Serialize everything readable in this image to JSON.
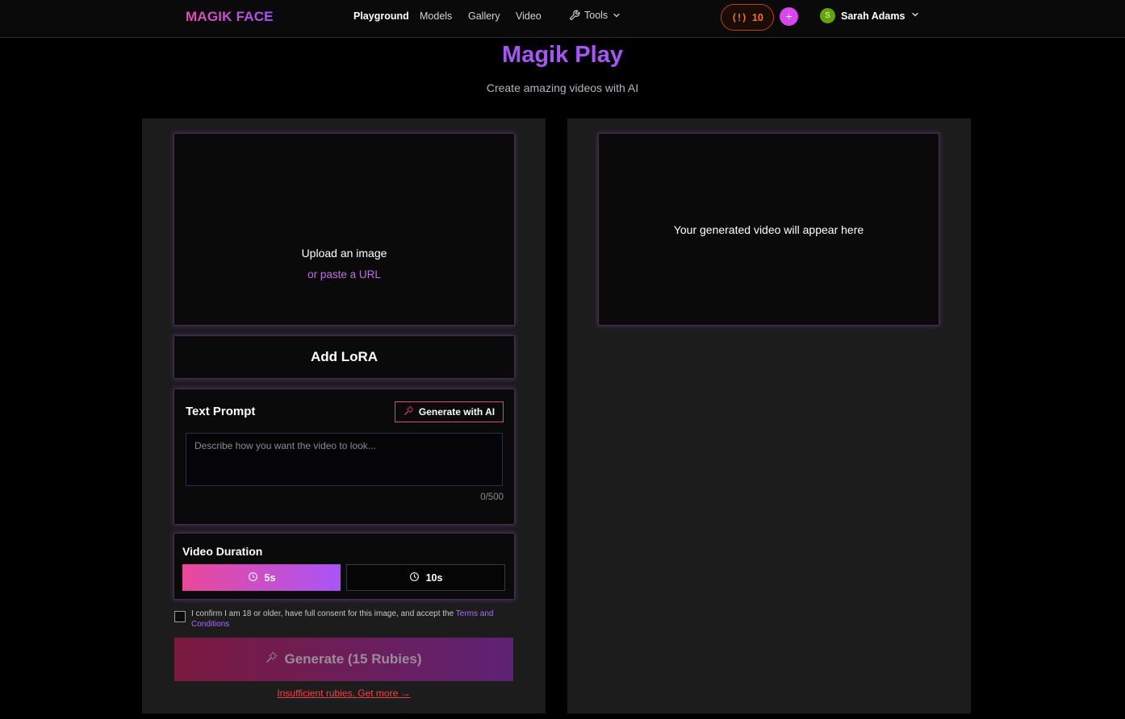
{
  "nav": {
    "logo": "MAGIK FACE",
    "links": [
      {
        "label": "Playground",
        "active": true
      },
      {
        "label": "Models",
        "active": false
      },
      {
        "label": "Gallery",
        "active": false
      },
      {
        "label": "Video",
        "active": false
      }
    ],
    "tools_label": "Tools",
    "ruby_icon": "(!)",
    "ruby_count": "10",
    "plus_label": "+",
    "user": {
      "initial": "S",
      "name": "Sarah Adams"
    }
  },
  "hero": {
    "title": "Magik Play",
    "subtitle": "Create amazing videos with AI"
  },
  "upload": {
    "title": "Upload an image",
    "url_link": "or paste a URL"
  },
  "lora": {
    "label": "Add LoRA"
  },
  "prompt": {
    "title": "Text Prompt",
    "generate_ai_label": "Generate with AI",
    "placeholder": "Describe how you want the video to look...",
    "value": "",
    "char_count": "0/500"
  },
  "duration": {
    "title": "Video Duration",
    "options": [
      {
        "label": "5s",
        "selected": true
      },
      {
        "label": "10s",
        "selected": false
      }
    ]
  },
  "consent": {
    "text": "I confirm I am 18 or older, have full consent for this image, and accept the ",
    "terms_link": "Terms and Conditions",
    "checked": false
  },
  "generate": {
    "label": "Generate (15 Rubies)",
    "insufficient": "Insufficient rubies. Get more →"
  },
  "preview": {
    "placeholder": "Your generated video will appear here"
  },
  "colors": {
    "accent_purple": "#a855f7",
    "accent_pink": "#ec4899",
    "ruby_orange": "#f97316",
    "error_red": "#ef4444"
  }
}
